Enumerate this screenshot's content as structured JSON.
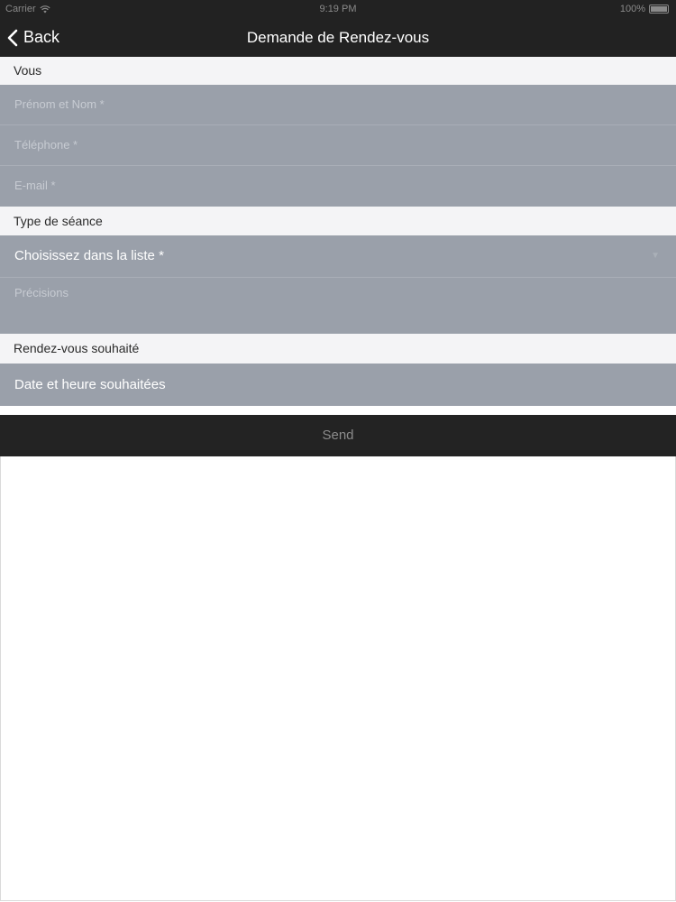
{
  "status_bar": {
    "carrier": "Carrier",
    "time": "9:19 PM",
    "battery": "100%",
    "wifi_icon": "wifi-icon",
    "battery_icon": "battery-icon"
  },
  "nav": {
    "back_label": "Back",
    "back_icon": "chevron-left-icon",
    "title": "Demande de Rendez-vous"
  },
  "sections": {
    "vous": "Vous",
    "type": "Type de séance",
    "rdv": "Rendez-vous souhaité"
  },
  "fields": {
    "name_placeholder": "Prénom et Nom *",
    "phone_placeholder": "Téléphone *",
    "email_placeholder": "E-mail *",
    "session_select": "Choisissez dans la liste *",
    "details_placeholder": "Précisions",
    "datetime_label": "Date et heure souhaitées"
  },
  "send_label": "Send",
  "colors": {
    "bar": "#222222",
    "field_bg": "#9aa0aa",
    "section_bg": "#f4f4f6",
    "send_bg": "#232323"
  }
}
